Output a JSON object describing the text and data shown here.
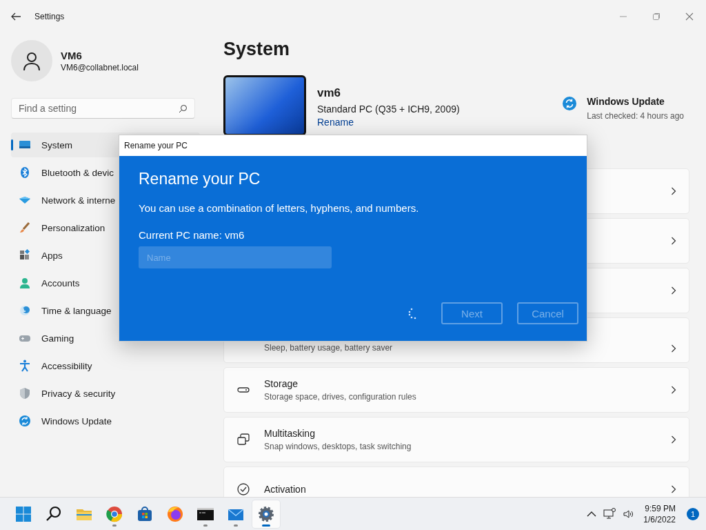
{
  "window": {
    "title": "Settings"
  },
  "user": {
    "name": "VM6",
    "email": "VM6@collabnet.local"
  },
  "search": {
    "placeholder": "Find a setting"
  },
  "sidebar": {
    "items": [
      {
        "label": "System",
        "selected": true
      },
      {
        "label": "Bluetooth & devic",
        "selected": false
      },
      {
        "label": "Network & interne",
        "selected": false
      },
      {
        "label": "Personalization",
        "selected": false
      },
      {
        "label": "Apps",
        "selected": false
      },
      {
        "label": "Accounts",
        "selected": false
      },
      {
        "label": "Time & language",
        "selected": false
      },
      {
        "label": "Gaming",
        "selected": false
      },
      {
        "label": "Accessibility",
        "selected": false
      },
      {
        "label": "Privacy & security",
        "selected": false
      },
      {
        "label": "Windows Update",
        "selected": false
      }
    ]
  },
  "page": {
    "title": "System"
  },
  "device": {
    "name": "vm6",
    "model": "Standard PC (Q35 + ICH9, 2009)",
    "rename_link": "Rename"
  },
  "update": {
    "title": "Windows Update",
    "status": "Last checked: 4 hours ago"
  },
  "cards": [
    {
      "kind": "covered"
    },
    {
      "kind": "covered"
    },
    {
      "kind": "covered"
    },
    {
      "kind": "partial",
      "subtitle": "Sleep, battery usage, battery saver"
    },
    {
      "kind": "full",
      "title": "Storage",
      "subtitle": "Storage space, drives, configuration rules"
    },
    {
      "kind": "full",
      "title": "Multitasking",
      "subtitle": "Snap windows, desktops, task switching"
    },
    {
      "kind": "full",
      "title": "Activation"
    }
  ],
  "dialog": {
    "window_title": "Rename your PC",
    "heading": "Rename your PC",
    "description": "You can use a combination of letters, hyphens, and numbers.",
    "current_name": "Current PC name: vm6",
    "field": {
      "placeholder": "Name"
    },
    "busy": true,
    "buttons": [
      {
        "label": "Next",
        "disabled": true
      },
      {
        "label": "Cancel",
        "disabled": true
      }
    ]
  },
  "taskbar": {
    "apps": [
      {
        "running": false,
        "selected": false
      },
      {
        "running": true,
        "selected": false
      },
      {
        "running": false,
        "selected": false
      },
      {
        "running": false,
        "selected": false
      },
      {
        "running": true,
        "selected": false
      },
      {
        "running": true,
        "selected": false
      },
      {
        "running": true,
        "selected": true
      }
    ],
    "time": "9:59 PM",
    "date": "1/6/2022",
    "notifications": "1"
  }
}
